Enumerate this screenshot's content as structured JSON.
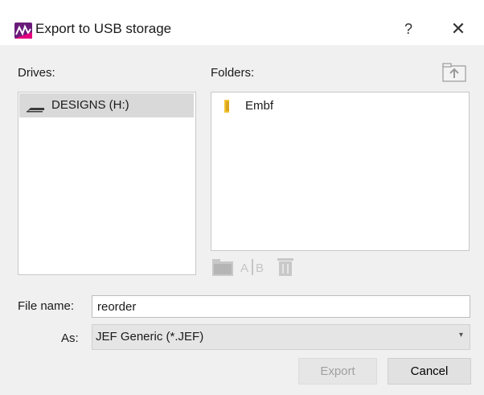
{
  "window": {
    "title": "Export to USB storage",
    "help_label": "?",
    "close_label": "✕"
  },
  "drives": {
    "label": "Drives:",
    "items": [
      {
        "label": "DESIGNS (H:)",
        "icon": "usb-drive-icon",
        "selected": true
      }
    ]
  },
  "folders": {
    "label": "Folders:",
    "items": [
      {
        "label": "Embf",
        "icon": "folder-icon"
      }
    ],
    "up_icon": "folder-up-icon",
    "tools": [
      {
        "icon": "new-folder-icon",
        "enabled": false
      },
      {
        "icon": "rename-icon",
        "enabled": false
      },
      {
        "icon": "delete-icon",
        "enabled": false
      }
    ]
  },
  "file_name": {
    "label": "File name:",
    "value": "reorder"
  },
  "as": {
    "label": "As:",
    "selected": "JEF Generic (*.JEF)"
  },
  "buttons": {
    "export": {
      "label": "Export",
      "enabled": false
    },
    "cancel": {
      "label": "Cancel",
      "enabled": true
    }
  },
  "colors": {
    "accent": "#6a1b7a",
    "folder": "#f2c230",
    "selection": "#d9d9d9"
  }
}
